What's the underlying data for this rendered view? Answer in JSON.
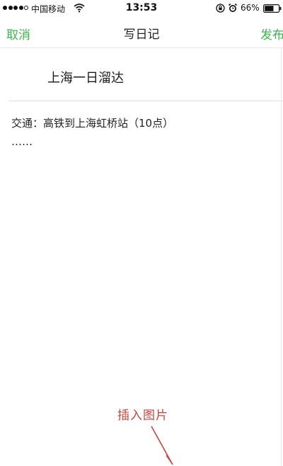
{
  "status_bar": {
    "carrier": "中国移动",
    "time": "13:53",
    "battery_percent": "66%",
    "battery_level": 0.66,
    "signal_bars_filled": 4,
    "signal_bars_total": 5,
    "icons": [
      "wifi-icon",
      "rotation-lock-icon",
      "alarm-icon",
      "battery-icon"
    ]
  },
  "nav": {
    "cancel_label": "取消",
    "title": "写日记",
    "publish_label": "发布"
  },
  "diary": {
    "title": "上海一日溜达",
    "body": "交通：高铁到上海虹桥站（10点）\n……"
  },
  "annotation": {
    "text": "插入图片"
  },
  "colors": {
    "accent": "#3fb34f",
    "annotation": "#c9443f",
    "background": "#ffffff"
  }
}
